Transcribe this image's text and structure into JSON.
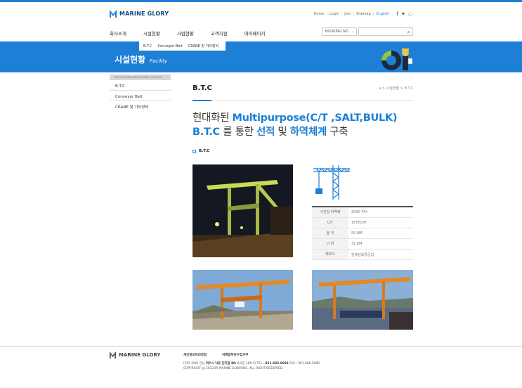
{
  "header": {
    "brand": "MARINE GLORY",
    "util_links": [
      "Home",
      "Login",
      "Join",
      "Sitemap",
      "English"
    ],
    "sns_icons": [
      "facebook-icon",
      "twitter-icon",
      "blog-icon"
    ]
  },
  "gnb": [
    "회사소개",
    "시설현황",
    "사업현황",
    "고객지원",
    "마이페이지"
  ],
  "booking": {
    "label": "BOOKING NO"
  },
  "search": {
    "placeholder": ""
  },
  "submenu": [
    "B.T.C",
    "Conveyor Belt",
    "CRANE 및 기타장비"
  ],
  "banner": {
    "title": "시설현황",
    "subtitle": "Facility"
  },
  "lnb": {
    "head": "PROFESSIONALIZED MARINE LOGISTICS",
    "items": [
      "B.T.C",
      "Conveyor Belt",
      "CRANE 및 기타장비"
    ]
  },
  "page": {
    "title": "B.T.C",
    "breadcrumb": [
      "시설현황",
      "B.T.C"
    ],
    "headline_parts": [
      "현대화된 ",
      "Multipurpose(C/T ,SALT,BULK)  B.T.C",
      " 를 통한 ",
      "선적",
      " 및 ",
      "하역체계",
      " 구축"
    ],
    "section": "B.T.C"
  },
  "specs": [
    {
      "k": "시간당 하역량",
      "v": "2000 T/H"
    },
    {
      "k": "C/T",
      "v": "16TEU/H"
    },
    {
      "k": "높 이",
      "v": "55.9M"
    },
    {
      "k": "너 비",
      "v": "31.6M"
    },
    {
      "k": "제조사",
      "v": "현대삼호중공업"
    }
  ],
  "footer": {
    "brand": "MARINE GLORY",
    "links": [
      "개인정보처리방침",
      "이메일무단수집거부"
    ],
    "addr_prefix": "(555-290) 전남 ",
    "addr_bold": "여수시 낙포 단지길 80",
    "addr_mid": "(낙포동 168-5) TEL : ",
    "tel": "061-683-0691",
    "fax": " FAX : 061-686-5080",
    "copyright": "COPYRIGHT @ 2013 BY MARINE GLORY.INC. ALL RIGHT RESERVED."
  },
  "colors": {
    "accent": "#1d7fd6",
    "brand": "#0f4a7a"
  }
}
